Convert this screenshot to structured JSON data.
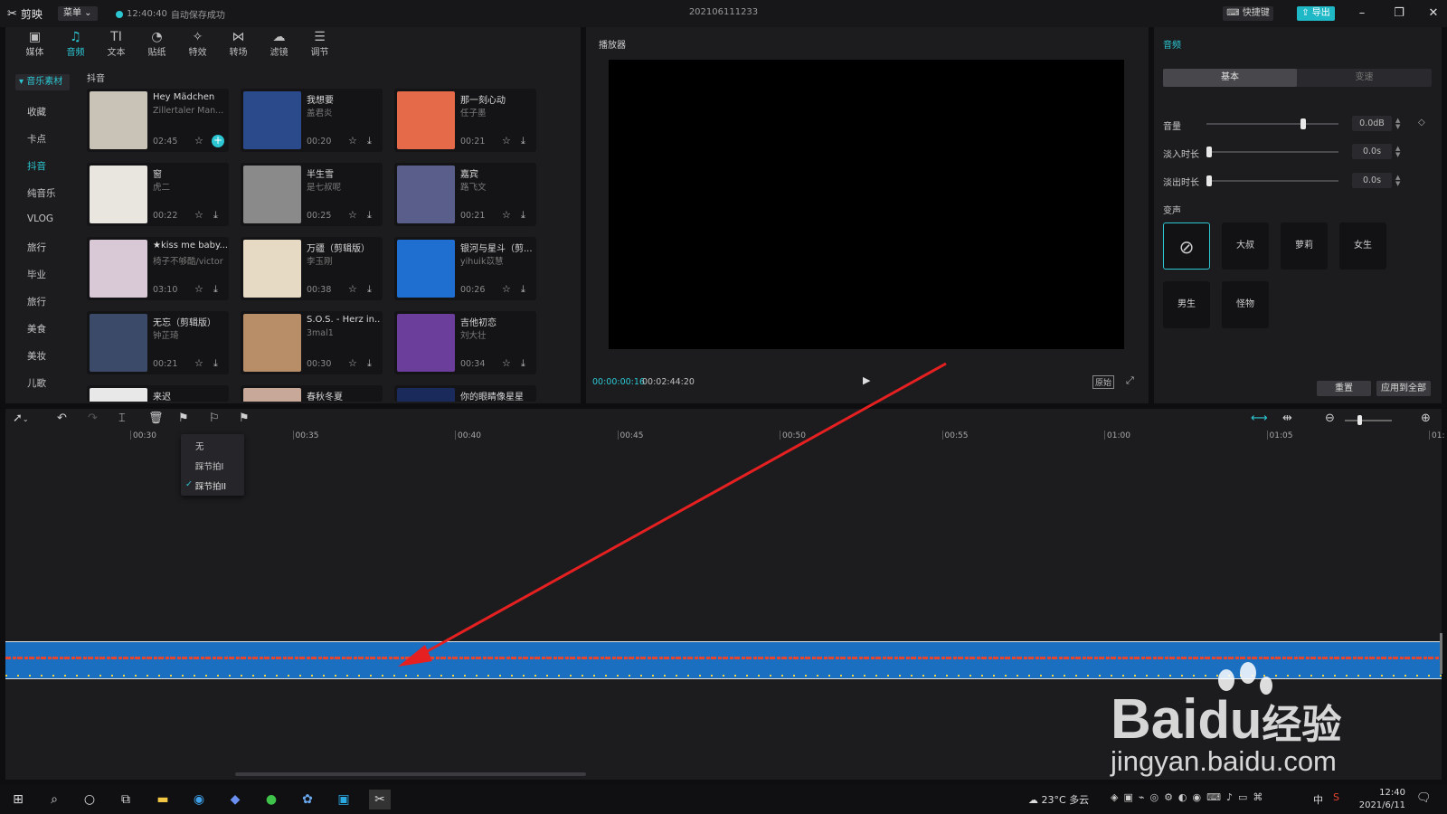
{
  "app": {
    "name": "剪映",
    "menu_label": "菜单",
    "autosave_time": "12:40:40",
    "autosave_text": "自动保存成功",
    "project_title": "202106111233",
    "shortcut_label": "快捷键",
    "export_label": "导出"
  },
  "toolbar": {
    "tabs": [
      {
        "label": "媒体",
        "icon": "media-icon"
      },
      {
        "label": "音频",
        "icon": "audio-icon"
      },
      {
        "label": "文本",
        "icon": "text-icon"
      },
      {
        "label": "贴纸",
        "icon": "sticker-icon"
      },
      {
        "label": "特效",
        "icon": "effects-icon"
      },
      {
        "label": "转场",
        "icon": "transition-icon"
      },
      {
        "label": "滤镜",
        "icon": "filter-icon"
      },
      {
        "label": "调节",
        "icon": "adjust-icon"
      }
    ]
  },
  "categories": {
    "header": "音乐素材",
    "items": [
      "收藏",
      "卡点",
      "抖音",
      "纯音乐",
      "VLOG",
      "旅行",
      "毕业",
      "旅行",
      "美食",
      "美妆",
      "儿歌"
    ],
    "active": "抖音"
  },
  "library": {
    "section_title": "抖音",
    "songs": [
      {
        "title": "Hey Mädchen",
        "artist": "Zillertaler Man...",
        "duration": "02:45",
        "thumb_color": "#c9c2b6"
      },
      {
        "title": "我想要",
        "artist": "盖君炎",
        "duration": "00:20",
        "thumb_color": "#2a4a8c"
      },
      {
        "title": "那一刻心动",
        "artist": "任子墨",
        "duration": "00:21",
        "thumb_color": "#e46a4a"
      },
      {
        "title": "窗",
        "artist": "虎二",
        "duration": "00:22",
        "thumb_color": "#e8e6df"
      },
      {
        "title": "半生雪",
        "artist": "是七叔呢",
        "duration": "00:25",
        "thumb_color": "#8a8a8a"
      },
      {
        "title": "嘉宾",
        "artist": "路飞文",
        "duration": "00:21",
        "thumb_color": "#5a5e8a"
      },
      {
        "title": "★kiss me baby...",
        "artist": "椅子不够酷/victor",
        "duration": "03:10",
        "thumb_color": "#d9c9d6"
      },
      {
        "title": "万疆（剪辑版）",
        "artist": "李玉刚",
        "duration": "00:38",
        "thumb_color": "#e6dac4"
      },
      {
        "title": "银河与星斗（剪...",
        "artist": "yihuik苡慧",
        "duration": "00:26",
        "thumb_color": "#1e6fd0"
      },
      {
        "title": "无忘（剪辑版）",
        "artist": "钟芷琦",
        "duration": "00:21",
        "thumb_color": "#3c4a6a"
      },
      {
        "title": "S.O.S. - Herz in...",
        "artist": "3mal1",
        "duration": "00:30",
        "thumb_color": "#b88e68"
      },
      {
        "title": "吉他初恋",
        "artist": "刘大壮",
        "duration": "00:34",
        "thumb_color": "#6a3e9a"
      },
      {
        "title": "来迟",
        "artist": "",
        "duration": "",
        "thumb_color": "#e8e8e8"
      },
      {
        "title": "春秋冬夏",
        "artist": "",
        "duration": "",
        "thumb_color": "#c8a898"
      },
      {
        "title": "你的眼睛像星星",
        "artist": "",
        "duration": "",
        "thumb_color": "#1a2a5a"
      }
    ]
  },
  "player": {
    "title": "播放器",
    "current_time": "00:00:00:16",
    "total_time": "00:02:44:20",
    "ratio_label": "原始"
  },
  "audio_panel": {
    "title": "音频",
    "tabs": [
      "基本",
      "变速"
    ],
    "params": [
      {
        "label": "音量",
        "value": "0.0dB",
        "level": 0.74
      },
      {
        "label": "淡入时长",
        "value": "0.0s",
        "level": 0.0
      },
      {
        "label": "淡出时长",
        "value": "0.0s",
        "level": 0.0
      }
    ],
    "voice_label": "变声",
    "voices": [
      "无",
      "大叔",
      "萝莉",
      "女生",
      "男生",
      "怪物"
    ],
    "reset_label": "重置",
    "apply_all_label": "应用到全部"
  },
  "timeline": {
    "ticks": [
      "00:30",
      "00:35",
      "00:40",
      "00:45",
      "00:50",
      "00:55",
      "01:00",
      "01:05",
      "01:"
    ],
    "dropdown": [
      "无",
      "踩节拍I",
      "踩节拍II"
    ],
    "dropdown_checked": "踩节拍II",
    "zoom_level": 0.27
  },
  "taskbar": {
    "temperature": "23°C",
    "weather": "多云",
    "ime": "中",
    "time": "12:40",
    "date": "2021/6/11"
  },
  "watermark": {
    "brand": "Bai",
    "brand2": "经验",
    "url": "jingyan.baidu.com"
  },
  "colors": {
    "accent": "#2cc7d3",
    "track": "#1a6fc0",
    "waveform": "#e8452f",
    "arrow": "#e62020"
  }
}
